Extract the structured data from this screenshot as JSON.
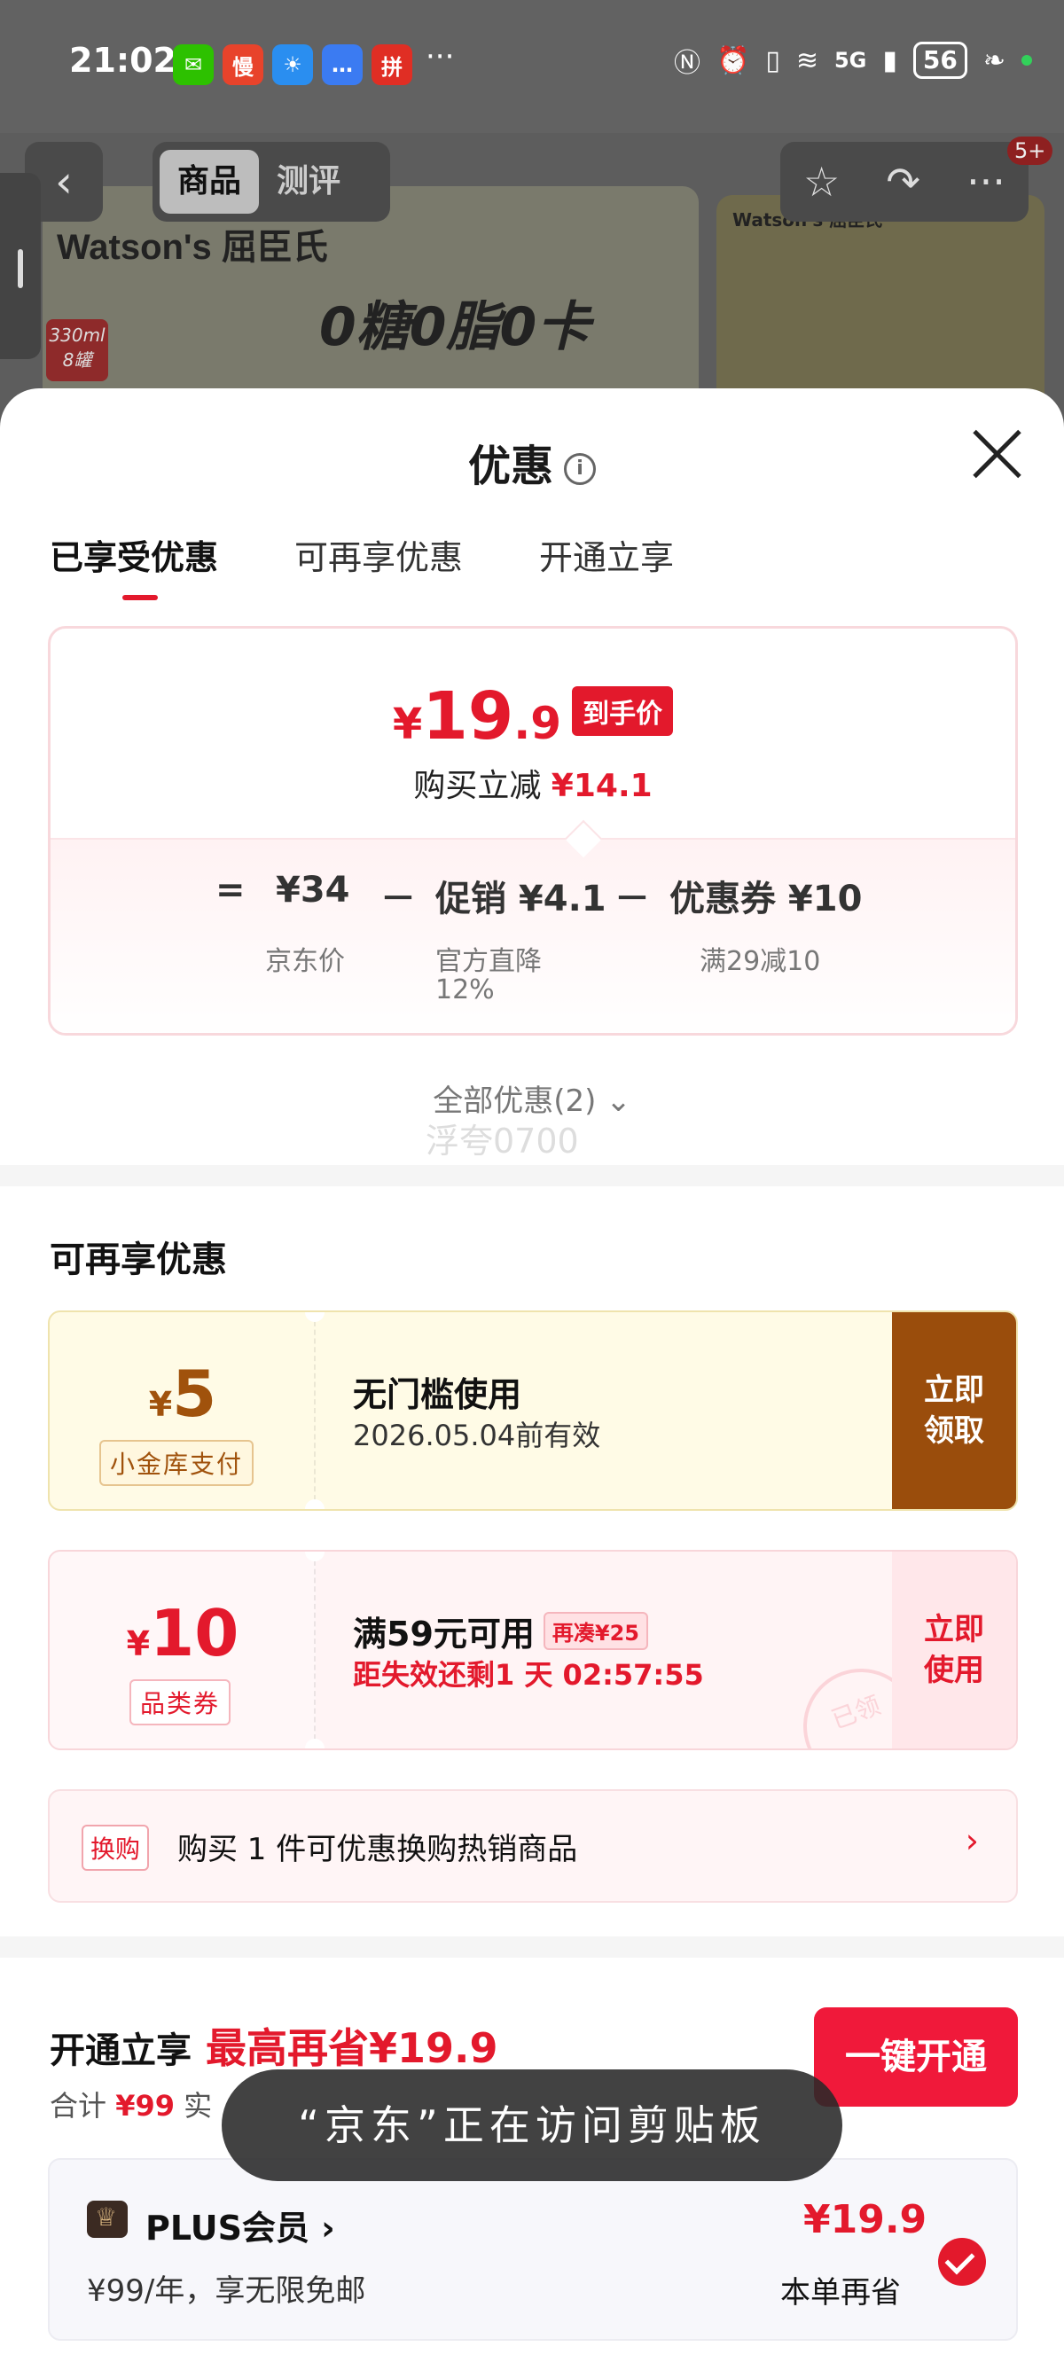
{
  "status": {
    "time": "21:02",
    "apps": [
      {
        "name": "wechat-icon",
        "glyph": "✉",
        "color": "#2dc100"
      },
      {
        "name": "man-app-icon",
        "glyph": "慢",
        "color": "#e8432b"
      },
      {
        "name": "weather-icon",
        "glyph": "☀",
        "color": "#2a8ef0"
      },
      {
        "name": "message-icon",
        "glyph": "…",
        "color": "#3b7bf2"
      },
      {
        "name": "pinduoduo-icon",
        "glyph": "拼",
        "color": "#e02e24"
      }
    ],
    "more": "···",
    "network": "5G",
    "battery": "56"
  },
  "product": {
    "brand": "Watson's 屈臣氏",
    "slogan": "0糖0脂0卡",
    "size_tag": "330ml 8罐",
    "right_brand": "Watson's 屈臣氏",
    "tabs": [
      "商品",
      "测评"
    ],
    "badge": "5+"
  },
  "sheet": {
    "title": "优惠",
    "tabs": [
      "已享受优惠",
      "可再享优惠",
      "开通立享"
    ]
  },
  "price": {
    "symbol": "¥",
    "integer": "19",
    "decimal": ".9",
    "badge": "到手价",
    "reduce_label": "购买立减",
    "reduce_value": "¥14.1",
    "eq": "=",
    "base": "¥34",
    "minus1": "－",
    "promo": "促销 ¥4.1",
    "minus2": "－",
    "coupon": "优惠券 ¥10",
    "base_note": "京东价",
    "promo_note_1": "官方直降",
    "promo_note_2": "12%",
    "coupon_note": "满29减10"
  },
  "all_discounts": "全部优惠(2) ⌄",
  "watermark": "浮夸0700",
  "more_section": {
    "title": "可再享优惠",
    "coupons": [
      {
        "yen": "¥",
        "amount": "5",
        "tag": "小金库支付",
        "desc": "无门槛使用",
        "sub": "2026.05.04前有效",
        "action": "立即\n领取"
      },
      {
        "yen": "¥",
        "amount": "10",
        "tag": "品类券",
        "desc": "满59元可用",
        "extra": "再凑¥25",
        "sub": "距失效还剩1 天 02:57:55",
        "action": "立即\n使用",
        "stamp": "已领"
      }
    ],
    "swap_tag": "换购",
    "swap_text": "购买 1 件可优惠换购热销商品",
    "swap_chev": "›"
  },
  "plus_section": {
    "title": "开通立享",
    "highlight": "最高再省¥19.9",
    "total_label": "合计",
    "total_value": "¥99",
    "total_suffix": "实",
    "open_button": "一键开通",
    "card_name": "PLUS会员 ›",
    "card_desc": "¥99/年，享无限免邮",
    "card_price": "¥19.9",
    "card_save": "本单再省"
  },
  "toast": "“京东”正在访问剪贴板"
}
